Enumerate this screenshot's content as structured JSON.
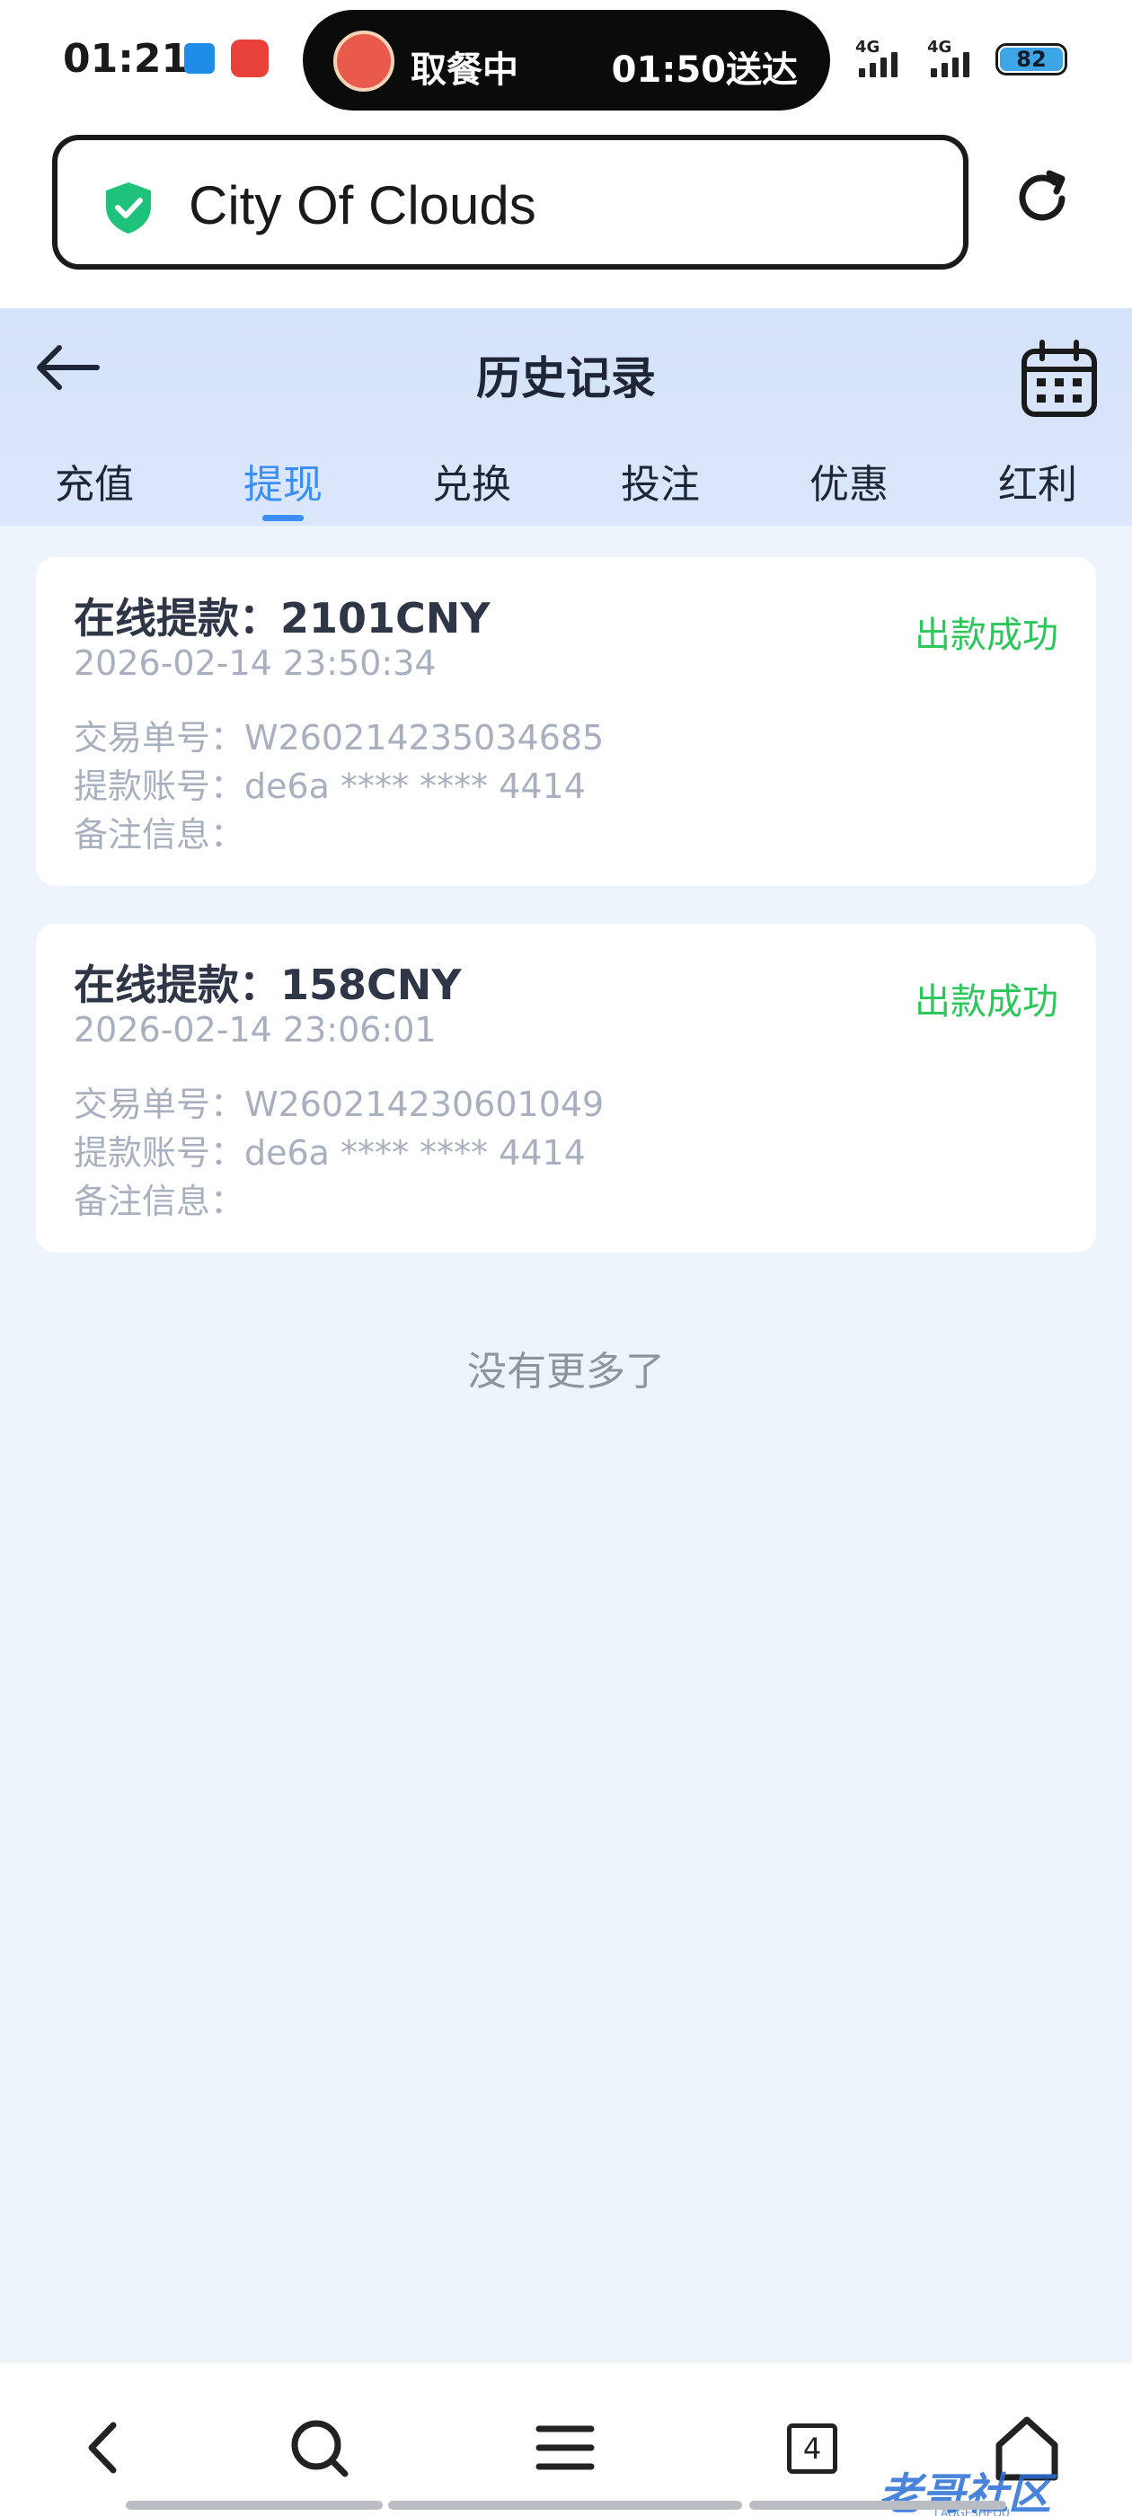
{
  "status_bar": {
    "time": "01:21",
    "island_left": "取餐中",
    "island_right": "01:50送达",
    "signal1": "4G",
    "signal2": "4G",
    "battery": "82"
  },
  "url_bar": {
    "url": "City Of Clouds"
  },
  "header": {
    "title": "历史记录",
    "tabs": [
      {
        "label": "充值",
        "active": false
      },
      {
        "label": "提现",
        "active": true
      },
      {
        "label": "兑换",
        "active": false
      },
      {
        "label": "投注",
        "active": false
      },
      {
        "label": "优惠",
        "active": false
      },
      {
        "label": "红利",
        "active": false
      }
    ]
  },
  "records": [
    {
      "title": "在线提款：2101CNY",
      "status": "出款成功",
      "time": "2026-02-14 23:50:34",
      "order": "交易单号：W260214235034685",
      "account": "提款账号：de6a **** **** 4414",
      "note": "备注信息："
    },
    {
      "title": "在线提款：158CNY",
      "status": "出款成功",
      "time": "2026-02-14 23:06:01",
      "order": "交易单号：W260214230601049",
      "account": "提款账号：de6a **** **** 4414",
      "note": "备注信息："
    }
  ],
  "list_footer": "没有更多了",
  "bottom_nav": {
    "tab_count": "4",
    "watermark": "老哥社区",
    "watermark_sub": "LAOGESHEQU"
  },
  "colors": {
    "accent": "#3a8ef6",
    "success": "#2cc65a",
    "header_bg": "#d4e2fa",
    "page_bg": "#eef4fc"
  }
}
